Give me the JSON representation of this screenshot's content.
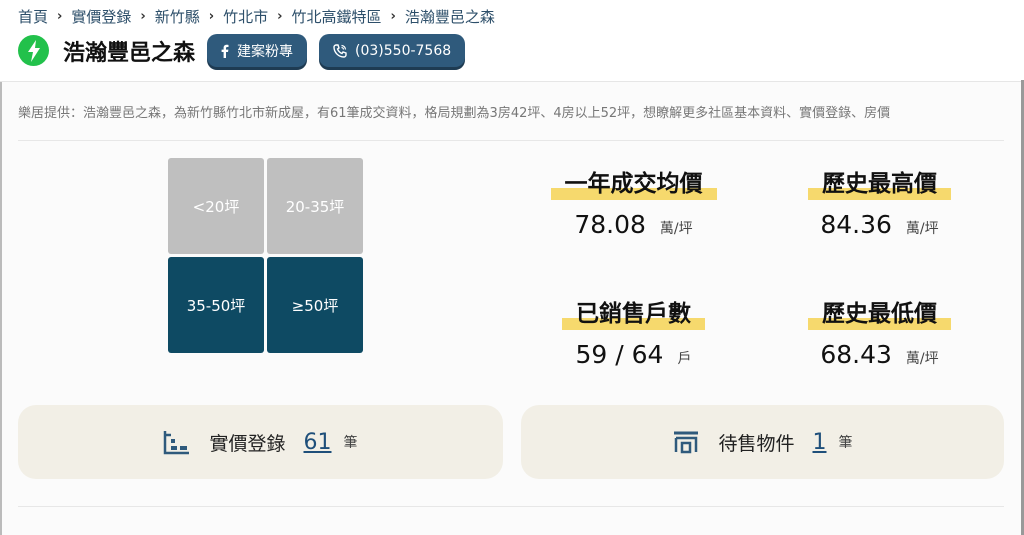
{
  "breadcrumb": [
    "首頁",
    "實價登錄",
    "新竹縣",
    "竹北市",
    "竹北高鐵特區",
    "浩瀚豐邑之森"
  ],
  "header": {
    "title": "浩瀚豐邑之森",
    "fb_label": "建案粉專",
    "phone_label": "(03)550-7568"
  },
  "description": "樂居提供：浩瀚豐邑之森，為新竹縣竹北市新成屋，有61筆成交資料，格局規劃為3房42坪、4房以上52坪，想瞭解更多社區基本資料、實價登錄、房價",
  "size_grid": {
    "cells": [
      "<20坪",
      "20-35坪",
      "35-50坪",
      "≥50坪"
    ]
  },
  "stats": {
    "avg_price": {
      "label": "一年成交均價",
      "value": "78.08",
      "unit": "萬/坪"
    },
    "max_price": {
      "label": "歷史最高價",
      "value": "84.36",
      "unit": "萬/坪"
    },
    "sold": {
      "label": "已銷售戶數",
      "value": "59 / 64",
      "unit": "戶"
    },
    "min_price": {
      "label": "歷史最低價",
      "value": "68.43",
      "unit": "萬/坪"
    }
  },
  "cards": {
    "transactions": {
      "label": "實價登錄",
      "count": "61",
      "unit": "筆"
    },
    "listings": {
      "label": "待售物件",
      "count": "1",
      "unit": "筆"
    }
  },
  "colors": {
    "accent": "#0e4a63",
    "highlight": "#f6d96d",
    "card_bg": "#f2efe6",
    "bolt": "#22c14b"
  }
}
